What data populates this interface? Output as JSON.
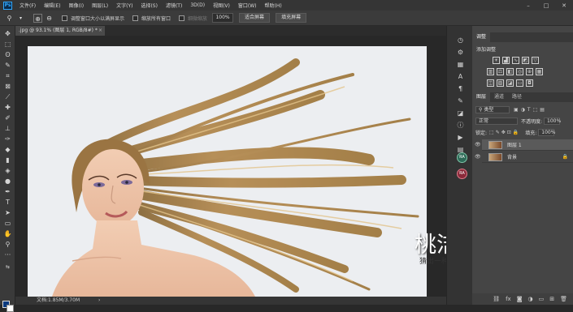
{
  "app": {
    "logo": "Ps"
  },
  "menu": [
    "文件(F)",
    "编辑(E)",
    "图像(I)",
    "图层(L)",
    "文字(Y)",
    "选择(S)",
    "滤镜(T)",
    "3D(D)",
    "视图(V)",
    "窗口(W)",
    "帮助(H)"
  ],
  "window_controls": {
    "minimize": "–",
    "maximize": "□",
    "close": "✕"
  },
  "options": {
    "resize_windows_label": "调整窗口大小以满屏显示",
    "zoom_all_label": "缩放所有窗口",
    "scrubby_label": "细微缩放",
    "zoom_value": "100%",
    "fit_screen": "适合屏幕",
    "fill_screen": "填充屏幕"
  },
  "document": {
    "tab_title": ".jpg @ 93.1% (图层 1, RGB/8#) *",
    "status": "文档:1.85M/3.70M"
  },
  "watermark": {
    "text": "桃洁的 韓總",
    "subtext": "猜出一种境界"
  },
  "panels": {
    "adjust_tab": "调整",
    "adjust_title": "添加调整",
    "layers_tab": "图层",
    "channels_tab": "通道",
    "paths_tab": "路径",
    "filter_kind": "类型",
    "blend_mode": "正常",
    "opacity_label": "不透明度:",
    "opacity_value": "100%",
    "lock_label": "锁定:",
    "fill_label": "填充:",
    "fill_value": "100%",
    "layers": [
      {
        "name": "图层 1",
        "selected": true
      },
      {
        "name": "背景",
        "selected": false
      }
    ]
  },
  "mini_panels": {
    "ra1": "RA",
    "ra2": "RA"
  },
  "colors": {
    "foreground": "#0c3a7e",
    "background": "#ffffff",
    "accent": "#31a8ff"
  }
}
